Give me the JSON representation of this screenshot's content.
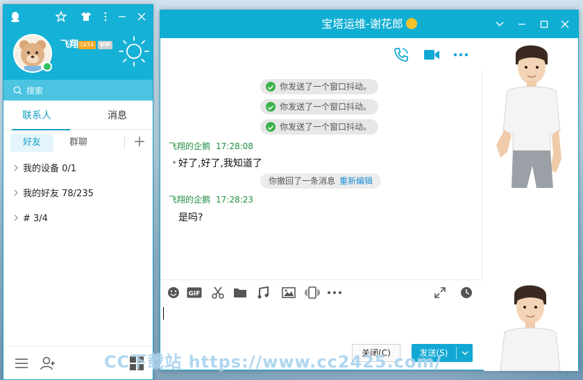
{
  "main": {
    "nickname": "飞翔",
    "level_badge": "LV34",
    "vip_badge": "VIP",
    "search_placeholder": "搜索",
    "tabs": [
      {
        "label": "联系人"
      },
      {
        "label": "消息"
      }
    ],
    "subtabs": [
      {
        "label": "好友"
      },
      {
        "label": "群聊"
      }
    ],
    "add_label": "+",
    "groups": [
      {
        "label": "我的设备 0/1"
      },
      {
        "label": "我的好友 78/235"
      },
      {
        "label": "# 3/4"
      }
    ]
  },
  "chat": {
    "title": "宝塔运维-谢花郎",
    "system_messages": [
      {
        "text": "你发送了一个窗口抖动。"
      },
      {
        "text": "你发送了一个窗口抖动。"
      },
      {
        "text": "你发送了一个窗口抖动。"
      }
    ],
    "messages": [
      {
        "sender": "飞翔的企鹅",
        "time": "17:28:08",
        "text": "好了,好了,我知道了"
      },
      {
        "sender": "飞翔的企鹅",
        "time": "17:28:23",
        "text": "是吗?"
      }
    ],
    "recall_notice": {
      "text": "你撤回了一条消息",
      "link": "重新编辑"
    },
    "buttons": {
      "close": "关闭(C)",
      "send": "发送(S)",
      "send_dropdown": "⌄"
    }
  },
  "watermark": "CC下载站  https://www.cc2425.com/",
  "colors": {
    "accent": "#10aed3",
    "sender_green": "#1e8e3e",
    "link_blue": "#1a8fd3",
    "check_green": "#3bb24a"
  }
}
